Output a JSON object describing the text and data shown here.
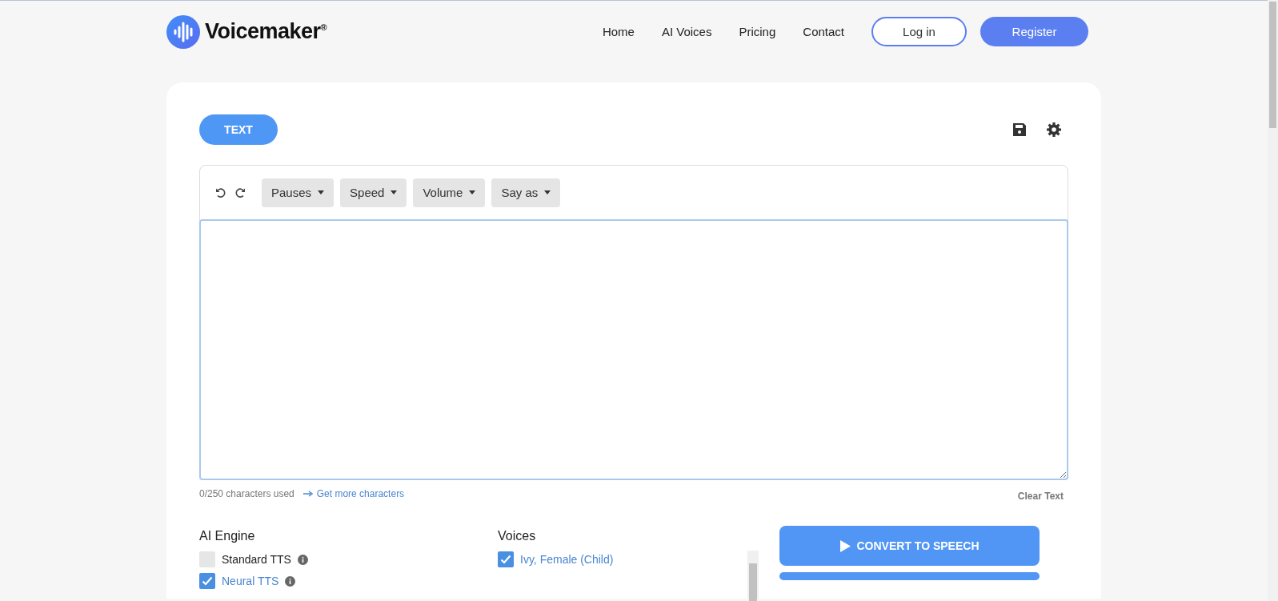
{
  "header": {
    "logo": "Voicemaker$^{®}$",
    "nav": [
      {
        "label": "Home"
      },
      {
        "label": "AI Voices"
      },
      {
        "label": "Pricing"
      },
      {
        "label": "Contact"
      }
    ],
    "login": "Log in",
    "register": "Register"
  },
  "mode_tab": {
    "label": "TEXT",
    "selected": true
  },
  "toolbar": {
    "dropdowns": [
      "Pauses",
      "Speed",
      "Volume",
      "Say as"
    ]
  },
  "counter": "0/250 characters used",
  "more_link": "Get more characters",
  "clear_button": "Clear Text",
  "engine": {
    "title": "AI Engine",
    "options": [
      {
        "label": "Standard TTS",
        "checked": false
      },
      {
        "label": "Neural TTS",
        "checked": true
      }
    ]
  },
  "voices": {
    "title": "Voices",
    "items": [
      {
        "label": "Ivy, Female (Child)",
        "checked": true
      }
    ]
  },
  "convert_button": "CONVERT TO SPEECH"
}
